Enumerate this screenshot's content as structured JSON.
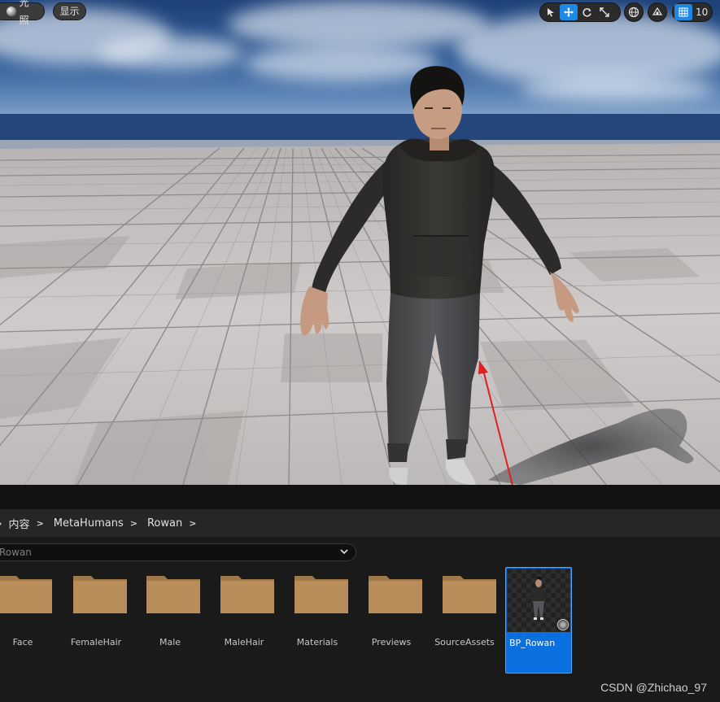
{
  "viewport": {
    "lighting_button": "光照",
    "show_button": "显示",
    "grid_value": "10",
    "colors": {
      "active_tool": "#1e88e5",
      "annotation_arrow": "#e02020"
    }
  },
  "content_browser": {
    "breadcrumb": [
      "内容",
      "MetaHumans",
      "Rowan"
    ],
    "path_text": "Rowan",
    "folders": [
      "Face",
      "FemaleHair",
      "Male",
      "MaleHair",
      "Materials",
      "Previews",
      "SourceAssets"
    ],
    "selected_asset": {
      "label": "BP_Rowan",
      "color": "#0a70e0"
    }
  },
  "watermark": "CSDN @Zhichao_97"
}
